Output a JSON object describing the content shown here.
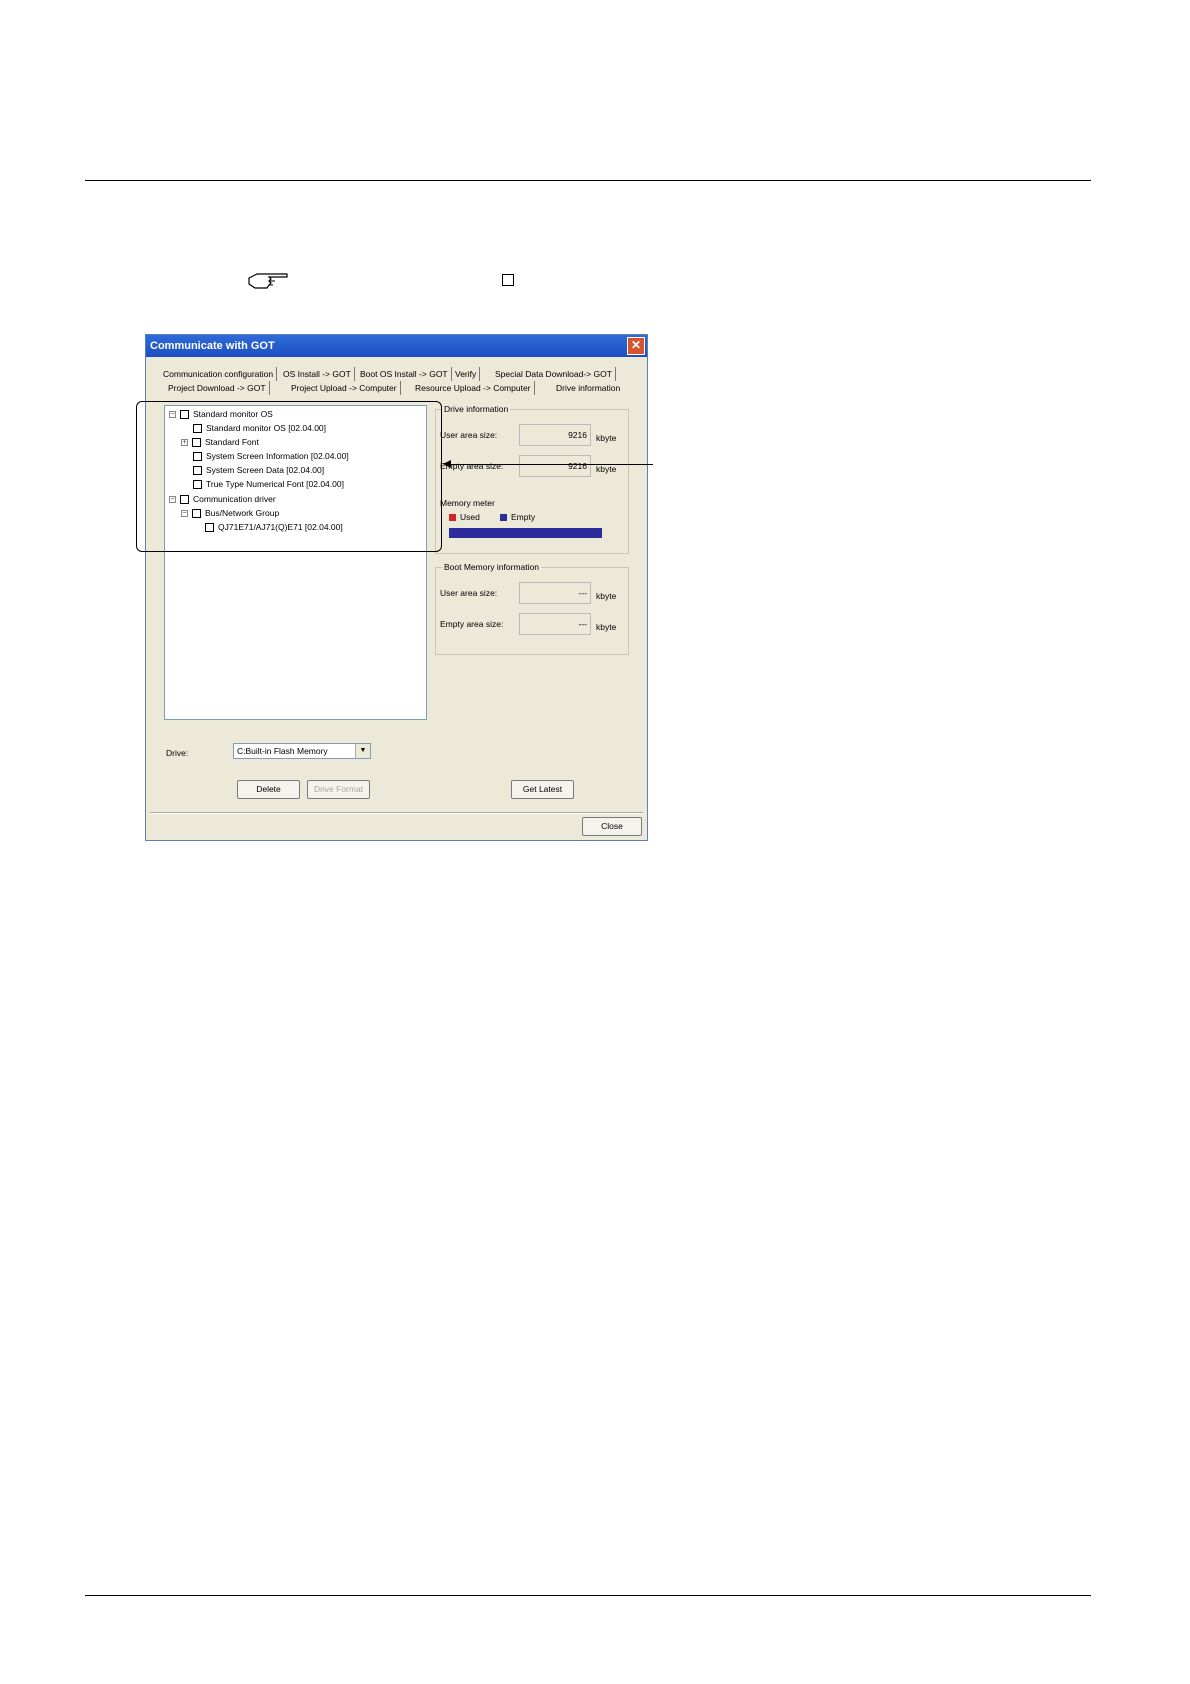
{
  "dialog": {
    "title": "Communicate with GOT",
    "tabs_row1": [
      "Communication configuration",
      "OS Install -> GOT",
      "Boot OS Install -> GOT",
      "Verify",
      "Special Data Download-> GOT"
    ],
    "tabs_row2": [
      "Project Download -> GOT",
      "Project Upload -> Computer",
      "Resource Upload -> Computer",
      "Drive information"
    ],
    "active_tab": "Drive information",
    "tree": [
      {
        "label": "Standard monitor OS",
        "level": 0,
        "expander": "-"
      },
      {
        "label": "Standard monitor OS [02.04.00]",
        "level": 1,
        "expander": ""
      },
      {
        "label": "Standard Font",
        "level": 1,
        "expander": "+"
      },
      {
        "label": "System Screen Information [02.04.00]",
        "level": 1,
        "expander": ""
      },
      {
        "label": "System Screen Data [02.04.00]",
        "level": 1,
        "expander": ""
      },
      {
        "label": "True Type Numerical Font [02.04.00]",
        "level": 1,
        "expander": ""
      },
      {
        "label": "Communication driver",
        "level": 0,
        "expander": "-"
      },
      {
        "label": "Bus/Network Group",
        "level": 1,
        "expander": "-"
      },
      {
        "label": "QJ71E71/AJ71(Q)E71 [02.04.00]",
        "level": 2,
        "expander": ""
      }
    ],
    "drive_info": {
      "title": "Drive information",
      "user_area_label": "User area size:",
      "user_area_value": "9216",
      "empty_area_label": "Empty area size:",
      "empty_area_value": "9216",
      "unit": "kbyte",
      "memory_meter_label": "Memory meter",
      "used_label": "Used",
      "empty_label": "Empty",
      "used_color": "#d0262e",
      "empty_color": "#2d2c9c",
      "used_fraction": 0
    },
    "boot_info": {
      "title": "Boot Memory information",
      "user_area_label": "User area size:",
      "user_area_value": "---",
      "empty_area_label": "Empty area size:",
      "empty_area_value": "---",
      "unit": "kbyte"
    },
    "drive_label": "Drive:",
    "drive_value": "C:Built-in Flash Memory",
    "buttons": {
      "delete": "Delete",
      "drive_format": "Drive Format",
      "get_latest": "Get Latest",
      "close": "Close"
    }
  }
}
